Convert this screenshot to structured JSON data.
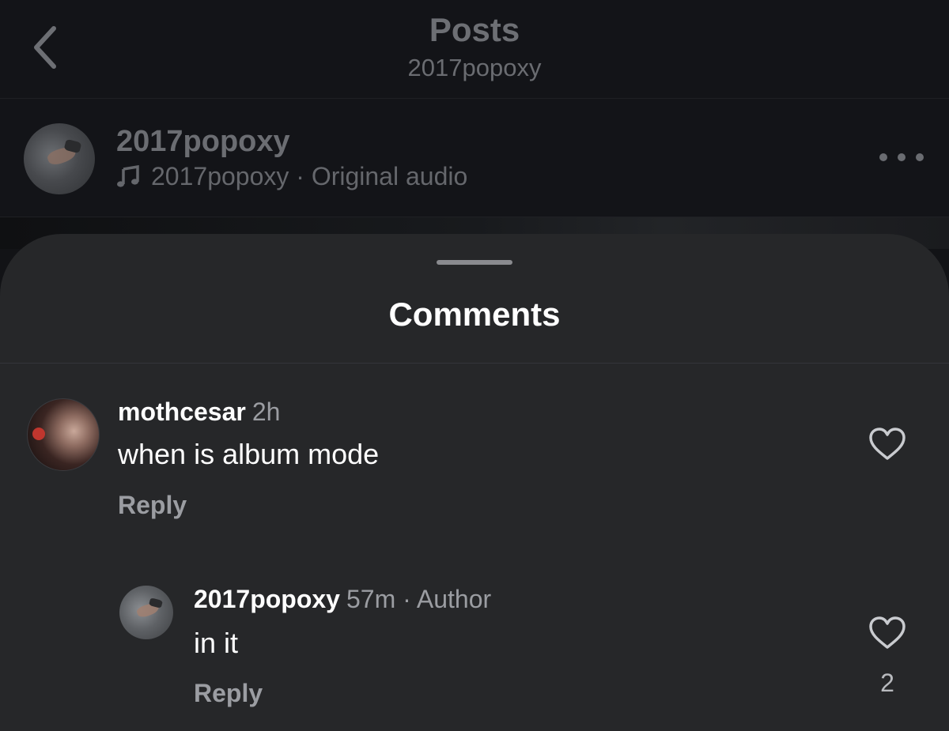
{
  "header": {
    "title": "Posts",
    "subtitle": "2017popoxy"
  },
  "post": {
    "username": "2017popoxy",
    "audio_label": "2017popoxy · Original audio"
  },
  "comments_sheet": {
    "title": "Comments",
    "comments": [
      {
        "username": "mothcesar",
        "time": "2h",
        "text": "when is album mode",
        "reply_label": "Reply"
      },
      {
        "username": "2017popoxy",
        "time": "57m · Author",
        "text": "in it",
        "reply_label": "Reply",
        "like_count": "2"
      }
    ]
  },
  "colors": {
    "sheet_background": "#262729",
    "page_background": "#121316",
    "primary_text": "#ffffff",
    "secondary_text": "#9b9da2"
  }
}
